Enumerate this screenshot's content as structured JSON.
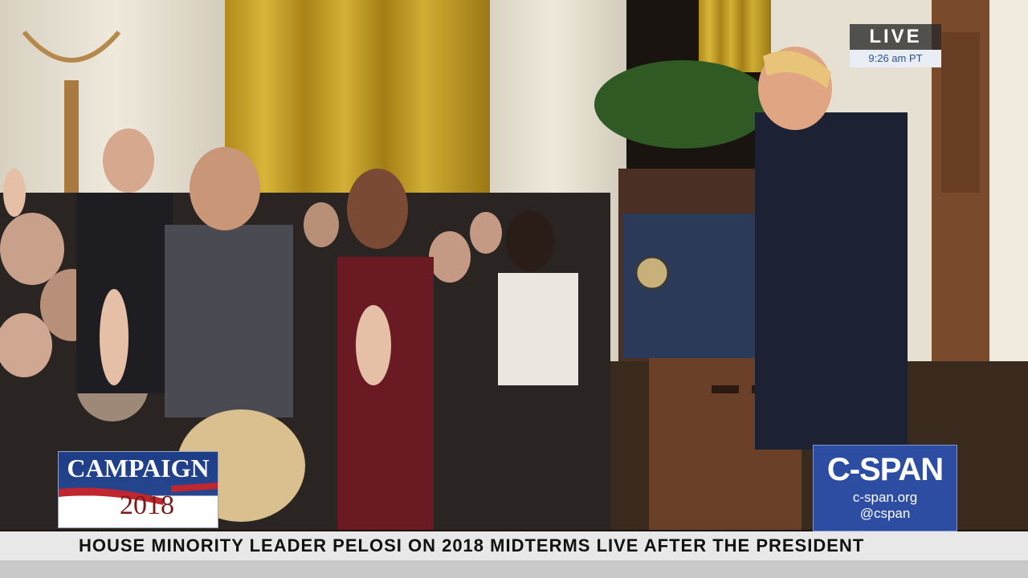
{
  "live_bug": {
    "label": "LIVE",
    "time": "9:26 am PT"
  },
  "campaign_logo": {
    "line1": "CAMPAIGN",
    "line2": "2018"
  },
  "network_logo": {
    "name": "C-SPAN",
    "website": "c-span.org",
    "handle": "@cspan"
  },
  "ticker": {
    "text": "HOUSE MINORITY LEADER PELOSI ON 2018 MIDTERMS LIVE AFTER THE PRESIDENT"
  },
  "colors": {
    "brand_blue": "#2d4da3",
    "live_time_text": "#2a4f9a",
    "curtain_gold": "#c9a52a"
  }
}
